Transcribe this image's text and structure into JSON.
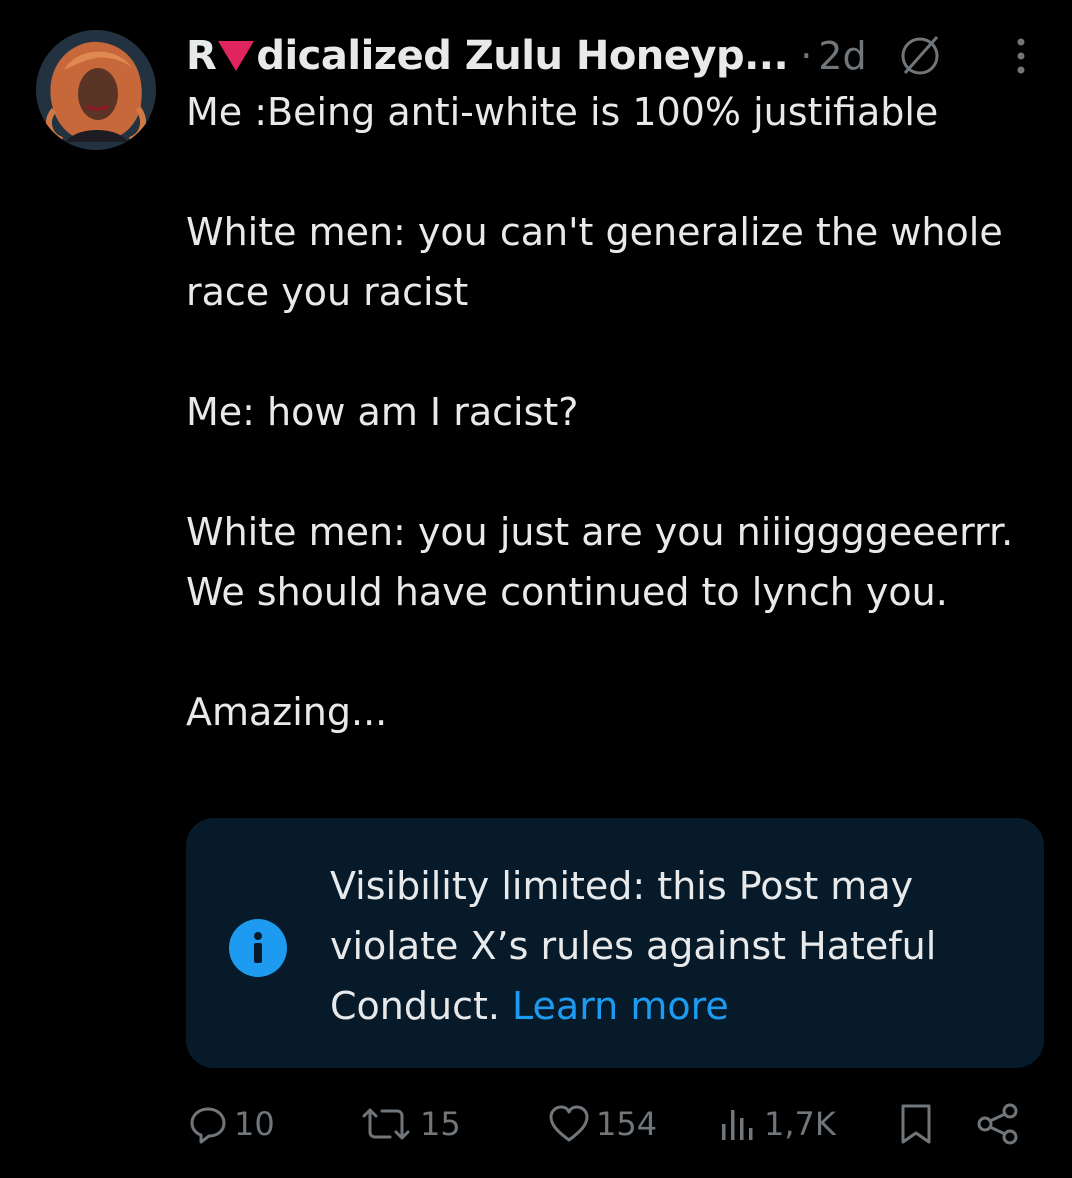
{
  "post": {
    "author": {
      "name_prefix": "R",
      "name_suffix": "dicalized Zulu Honeyp...",
      "separator": "·",
      "time": "2d"
    },
    "text": "Me :Being anti-white is 100% justifiable\n\nWhite men: you can't generalize the whole race you racist\n\nMe: how am I racist?\n\nWhite men: you just are you niiiggggeeerrr. We should have continued to lynch you.\n\nAmazing...",
    "notice": {
      "message": "Visibility limited: this Post may violate X’s rules against Hateful Conduct.",
      "link_label": "Learn more"
    },
    "actions": {
      "replies": "10",
      "reposts": "15",
      "likes": "154",
      "views": "1,7K"
    }
  },
  "icons": {
    "header": [
      "red-triangle-icon",
      "no-entry-icon",
      "more-vertical-icon"
    ],
    "notice": "info-icon",
    "actions": [
      "reply-icon",
      "repost-icon",
      "like-icon",
      "views-icon",
      "bookmark-icon",
      "share-icon"
    ]
  },
  "colors": {
    "background": "#000000",
    "text": "#e7e9ea",
    "muted": "#71767b",
    "link": "#1d9bf0",
    "notice_bg": "#061a29",
    "triangle": "#e0245e"
  }
}
